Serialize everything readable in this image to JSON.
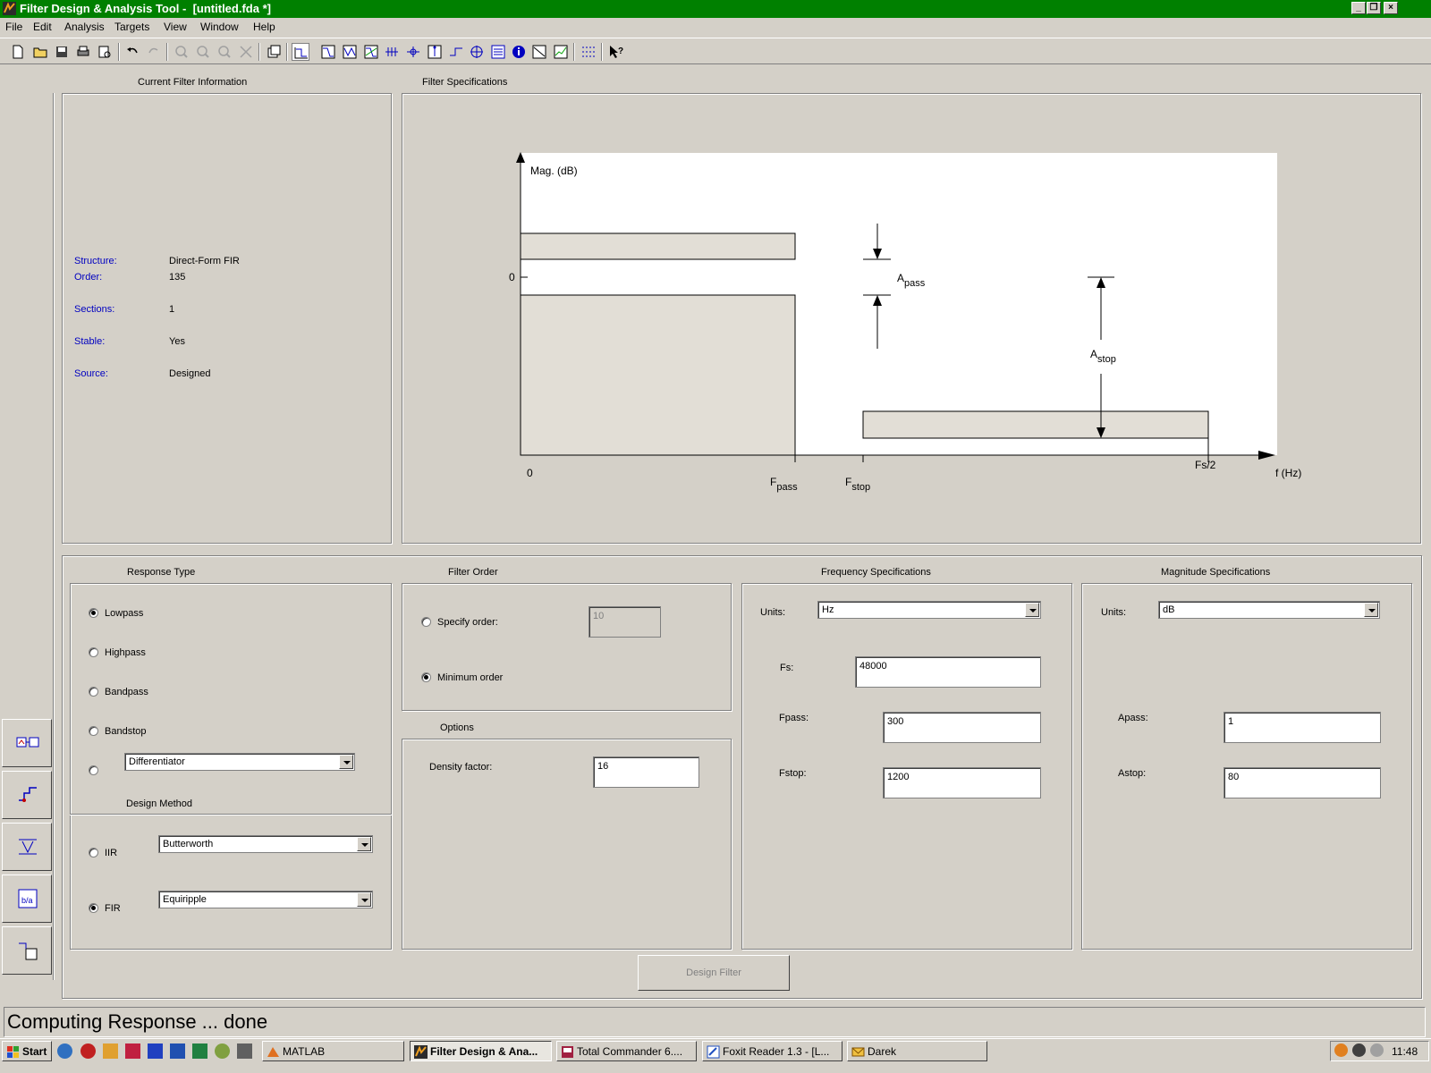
{
  "window": {
    "title": "Filter Design & Analysis Tool -  [untitled.fda *]",
    "min_label": "_",
    "max_label": "❐",
    "close_label": "×"
  },
  "menu": [
    "File",
    "Edit",
    "Analysis",
    "Targets",
    "View",
    "Window",
    "Help"
  ],
  "current_filter": {
    "title": "Current Filter Information",
    "rows": [
      {
        "label": "Structure:",
        "value": "Direct-Form FIR"
      },
      {
        "label": "Order:",
        "value": "135"
      },
      {
        "label": "Sections:",
        "value": "1"
      },
      {
        "label": "Stable:",
        "value": "Yes"
      },
      {
        "label": "Source:",
        "value": "Designed"
      }
    ]
  },
  "filter_spec": {
    "title": "Filter Specifications",
    "y_label": "Mag. (dB)",
    "zero_y": "0",
    "zero_x": "0",
    "fpass_main": "F",
    "fpass_sub": "pass",
    "fstop_main": "F",
    "fstop_sub": "stop",
    "fs2": "Fs/2",
    "x_label": "f (Hz)",
    "apass_main": "A",
    "apass_sub": "pass",
    "astop_main": "A",
    "astop_sub": "stop"
  },
  "response_type": {
    "title": "Response Type",
    "options": [
      "Lowpass",
      "Highpass",
      "Bandpass",
      "Bandstop"
    ],
    "selected": "Lowpass",
    "other_value": "Differentiator"
  },
  "design_method": {
    "title": "Design Method",
    "iir_label": "IIR",
    "iir_value": "Butterworth",
    "fir_label": "FIR",
    "fir_value": "Equiripple",
    "selected": "FIR"
  },
  "filter_order": {
    "title": "Filter Order",
    "specify_label": "Specify order:",
    "specify_value": "10",
    "minimum_label": "Minimum order",
    "selected": "Minimum order"
  },
  "options": {
    "title": "Options",
    "density_label": "Density factor:",
    "density_value": "16"
  },
  "frequency_spec": {
    "title": "Frequency Specifications",
    "units_label": "Units:",
    "units_value": "Hz",
    "fs_label": "Fs:",
    "fs_value": "48000",
    "fpass_label": "Fpass:",
    "fpass_value": "300",
    "fstop_label": "Fstop:",
    "fstop_value": "1200"
  },
  "magnitude_spec": {
    "title": "Magnitude Specifications",
    "units_label": "Units:",
    "units_value": "dB",
    "apass_label": "Apass:",
    "apass_value": "1",
    "astop_label": "Astop:",
    "astop_value": "80"
  },
  "design_button": "Design Filter",
  "status": "Computing Response ... done",
  "taskbar": {
    "start": "Start",
    "tasks": [
      "MATLAB",
      "Filter Design & Ana...",
      "Total Commander 6....",
      "Foxit Reader 1.3 - [L...",
      "Darek"
    ],
    "active_task": "Filter Design & Ana...",
    "clock": "11:48"
  }
}
